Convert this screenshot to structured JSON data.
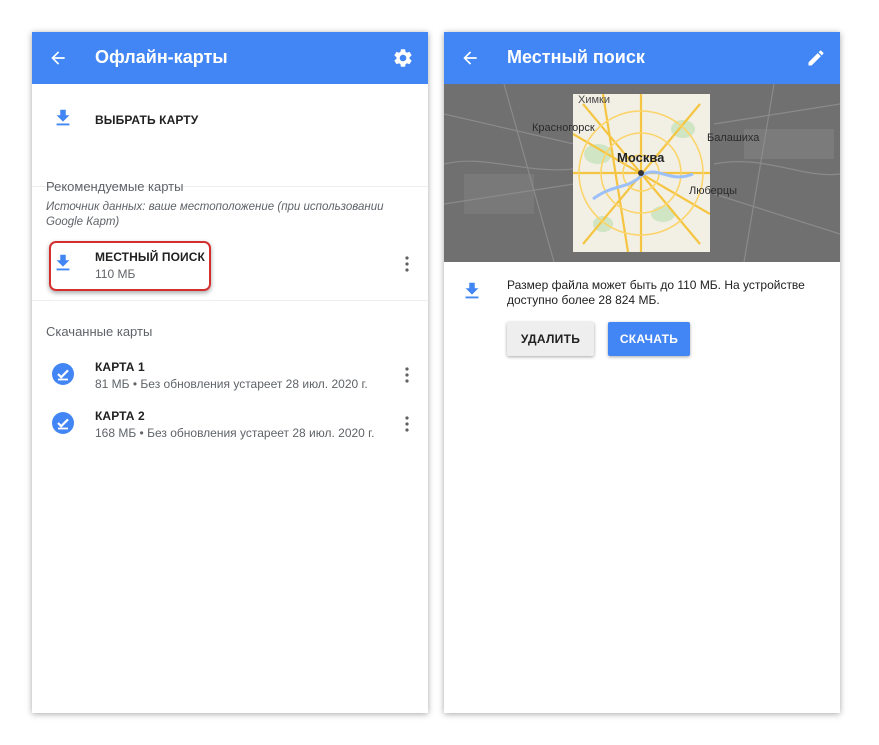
{
  "colors": {
    "appbar": "#4285f4",
    "accent": "#4285f4",
    "highlight": "#d32f2f",
    "downloaded_check": "#4285f4"
  },
  "left_screen": {
    "appbar": {
      "title": "Офлайн-карты",
      "back_icon": "arrow-back-icon",
      "settings_icon": "gear-icon"
    },
    "choose_map": {
      "label": "ВЫБРАТЬ КАРТУ",
      "icon": "download-icon"
    },
    "recommended": {
      "header": "Рекомендуемые карты",
      "note": "Источник данных: ваше местоположение (при использовании Google Карт)",
      "items": [
        {
          "name": "МЕСТНЫЙ ПОИСК",
          "size": "110 МБ",
          "icon": "download-icon"
        }
      ]
    },
    "downloaded": {
      "header": "Скачанные карты",
      "items": [
        {
          "name": "КАРТА 1",
          "details": "81 МБ • Без обновления устареет 28 июл. 2020 г.",
          "icon": "check-circle-icon"
        },
        {
          "name": "КАРТА 2",
          "details": "168 МБ • Без обновления устареет 28 июл. 2020 г.",
          "icon": "check-circle-icon"
        }
      ]
    }
  },
  "right_screen": {
    "appbar": {
      "title": "Местный поиск",
      "back_icon": "arrow-back-icon",
      "edit_icon": "pencil-icon"
    },
    "map": {
      "labels": [
        "Химки",
        "Красногорск",
        "Москва",
        "Балашиха",
        "Люберцы"
      ]
    },
    "info": {
      "text": "Размер файла может быть до 110 МБ. На устройстве доступно более 28 824 МБ."
    },
    "buttons": {
      "delete": "УДАЛИТЬ",
      "download": "СКАЧАТЬ"
    }
  }
}
